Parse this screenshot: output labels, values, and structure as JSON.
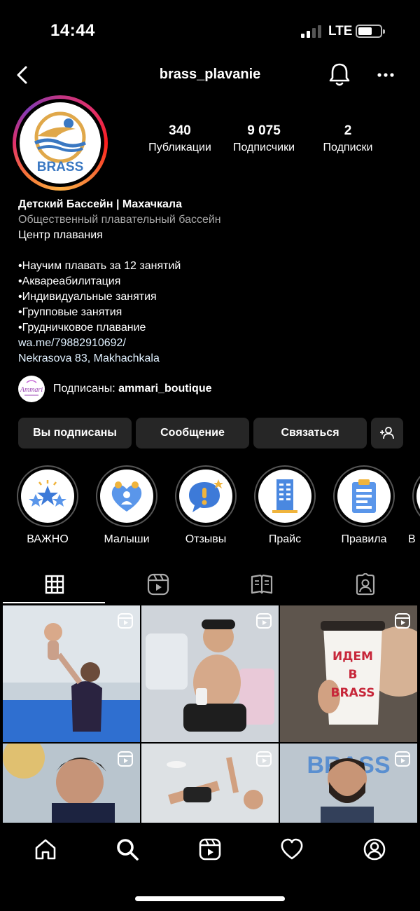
{
  "status": {
    "time": "14:44",
    "network": "LTE"
  },
  "header": {
    "username": "brass_plavanie"
  },
  "profile": {
    "avatar_text": "BRASS",
    "stats": [
      {
        "value": "340",
        "label": "Публикации"
      },
      {
        "value": "9 075",
        "label": "Подписчики"
      },
      {
        "value": "2",
        "label": "Подписки"
      }
    ],
    "name": "Детский Бассейн | Махачкала",
    "category": "Общественный плавательный бассейн",
    "bio_lines": [
      "Центр плавания",
      "",
      "•Научим плавать за 12 занятий",
      "•Аквареабилитация",
      "•Индивидуальные занятия",
      "•Групповые занятия",
      "•Грудничковое плавание"
    ],
    "link": "wa.me/79882910692/",
    "address": "Nekrasova 83, Makhachkala",
    "followed_by_prefix": "Подписаны:",
    "followed_by_user": "ammari_boutique",
    "followed_by_avatar_text": "Ammari"
  },
  "buttons": {
    "following": "Вы подписаны",
    "message": "Сообщение",
    "contact": "Связаться"
  },
  "highlights": [
    {
      "label": "ВАЖНО",
      "icon": "stars-icon"
    },
    {
      "label": "Малыши",
      "icon": "family-icon"
    },
    {
      "label": "Отзывы",
      "icon": "speech-exclamation-icon"
    },
    {
      "label": "Прайс",
      "icon": "building-icon"
    },
    {
      "label": "Правила",
      "icon": "clipboard-icon"
    },
    {
      "label": "В",
      "icon": "partial-icon"
    }
  ],
  "cup_text_line1": "ИДЕМ",
  "cup_text_line2": "В",
  "cup_text_line3": "BRASS",
  "banner_text": "BRASS",
  "colors": {
    "background": "#000000",
    "button_bg": "#262626",
    "secondary_text": "#a8a8a8",
    "brand_blue": "#3a78c2",
    "brand_gold": "#e0a84a"
  }
}
